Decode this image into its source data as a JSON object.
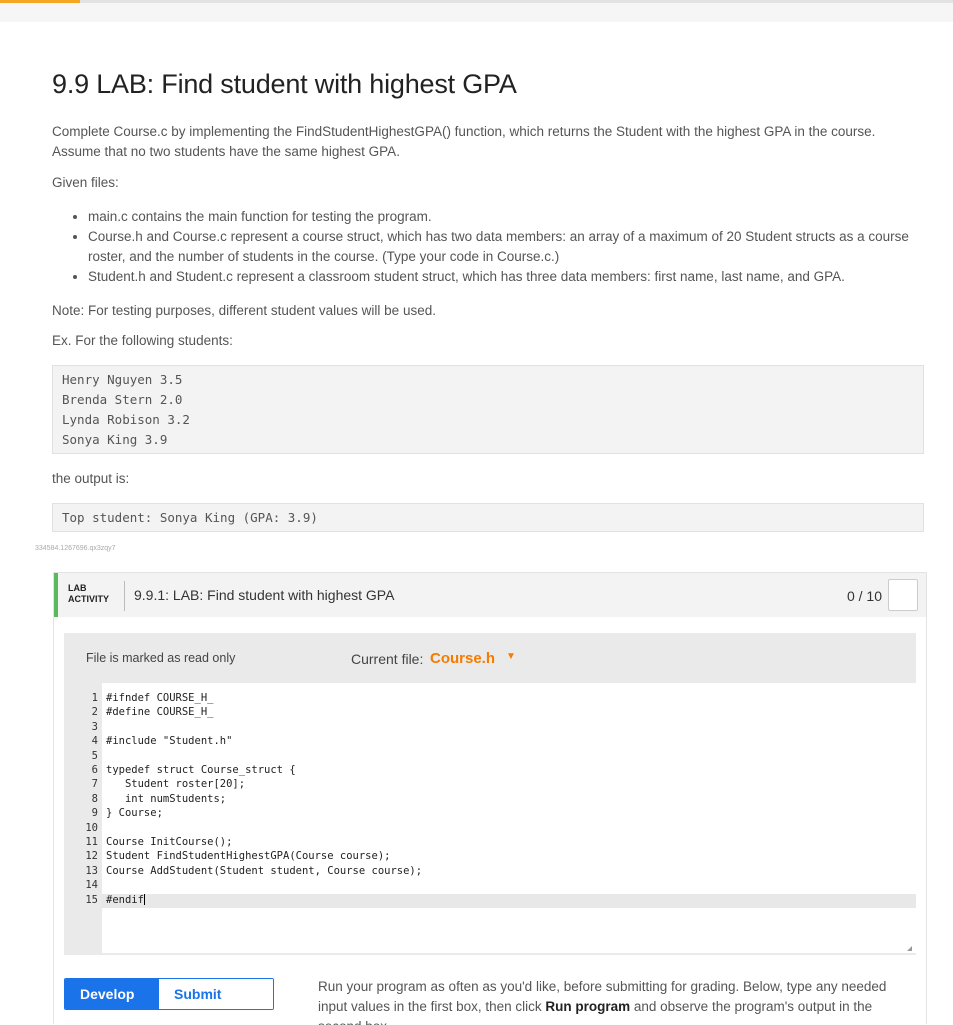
{
  "page": {
    "title": "9.9 LAB: Find student with highest GPA",
    "intro_1": "Complete Course.c by implementing the FindStudentHighestGPA() function, which returns the Student with the highest GPA in the course. Assume that no two students have the same highest GPA.",
    "given_files_label": "Given files:",
    "files": [
      "main.c contains the main function for testing the program.",
      "Course.h and Course.c represent a course struct, which has two data members: an array of a maximum of 20 Student structs as a course roster, and the number of students in the course. (Type your code in Course.c.)",
      "Student.h and Student.c represent a classroom student struct, which has three data members: first name, last name, and GPA."
    ],
    "note": "Note: For testing purposes, different student values will be used.",
    "example_label": "Ex. For the following students:",
    "example_input": [
      "Henry Nguyen 3.5",
      "Brenda Stern 2.0",
      "Lynda Robison 3.2",
      "Sonya King 3.9"
    ],
    "output_label": "the output is:",
    "example_output": "Top student: Sonya King (GPA: 3.9)",
    "tracking_id": "334584.1267696.qx3zqy7"
  },
  "lab": {
    "tag_line1": "LAB",
    "tag_line2": "ACTIVITY",
    "title": "9.9.1: LAB: Find student with highest GPA",
    "score": "0 / 10",
    "colors": {
      "accent_green": "#5cb85c",
      "file_orange": "#f57c00",
      "button_blue": "#1a73e8"
    }
  },
  "editor": {
    "readonly_text": "File is marked as read only",
    "current_file_label": "Current file:",
    "current_file": "Course.h",
    "caret_icon": "caret-down-icon",
    "lines": [
      {
        "n": "1",
        "text": "#ifndef COURSE_H_"
      },
      {
        "n": "2",
        "text": "#define COURSE_H_"
      },
      {
        "n": "3",
        "text": ""
      },
      {
        "n": "4",
        "text": "#include \"Student.h\""
      },
      {
        "n": "5",
        "text": ""
      },
      {
        "n": "6",
        "text": "typedef struct Course_struct {"
      },
      {
        "n": "7",
        "text": "   Student roster[20];"
      },
      {
        "n": "8",
        "text": "   int numStudents;"
      },
      {
        "n": "9",
        "text": "} Course;"
      },
      {
        "n": "10",
        "text": ""
      },
      {
        "n": "11",
        "text": "Course InitCourse();"
      },
      {
        "n": "12",
        "text": "Student FindStudentHighestGPA(Course course);"
      },
      {
        "n": "13",
        "text": "Course AddStudent(Student student, Course course);"
      },
      {
        "n": "14",
        "text": ""
      },
      {
        "n": "15",
        "text": "#endif"
      }
    ]
  },
  "modes": {
    "develop": "Develop mode",
    "submit": "Submit mode",
    "run_text_1": "Run your program as often as you'd like, before submitting for grading. Below, type any needed input values in the first box, then click ",
    "run_text_bold": "Run program",
    "run_text_2": " and observe the program's output in the second box."
  }
}
